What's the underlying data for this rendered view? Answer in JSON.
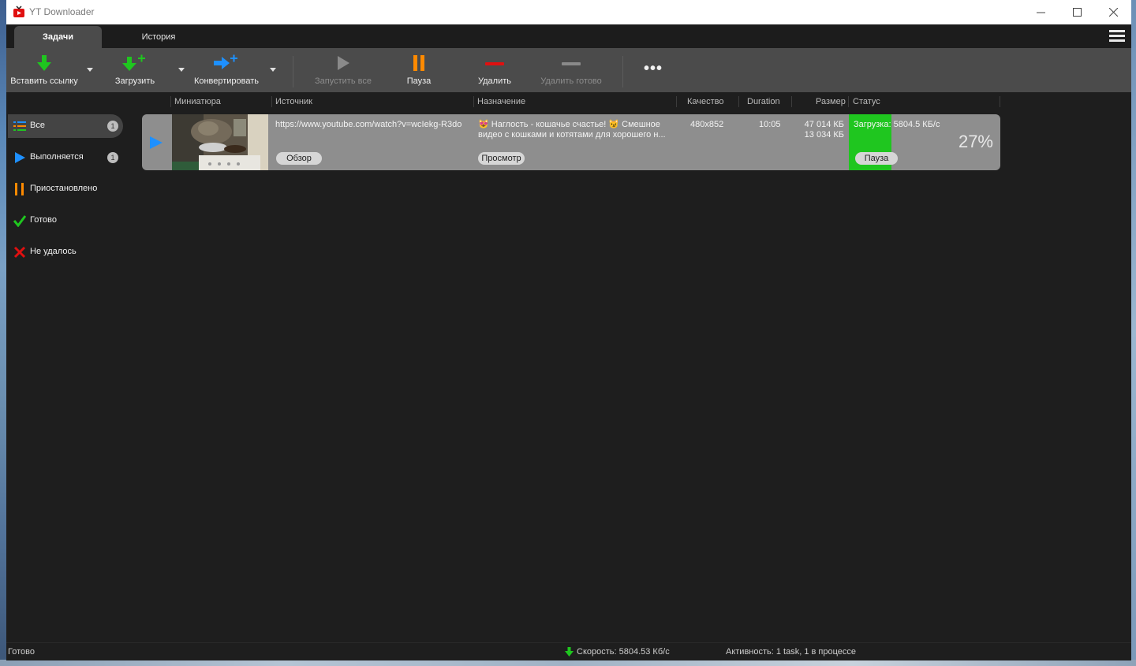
{
  "window": {
    "title": "YT Downloader",
    "controls": {
      "minimize": "—",
      "maximize": "☐",
      "close": "✕"
    }
  },
  "tabs": [
    {
      "label": "Задачи",
      "active": true
    },
    {
      "label": "История",
      "active": false
    }
  ],
  "toolbar": {
    "paste_link": "Вставить ссылку",
    "download": "Загрузить",
    "convert": "Конвертировать",
    "start_all": "Запустить все",
    "pause": "Пауза",
    "delete": "Удалить",
    "delete_done": "Удалить готово",
    "more": "•••"
  },
  "sidebar": {
    "items": [
      {
        "label": "Все",
        "icon": "list-icon",
        "badge": "1",
        "active": true
      },
      {
        "label": "Выполняется",
        "icon": "play-icon",
        "badge": "1"
      },
      {
        "label": "Приостановлено",
        "icon": "pause-icon"
      },
      {
        "label": "Готово",
        "icon": "checkmark-icon"
      },
      {
        "label": "Не удалось",
        "icon": "cross-icon"
      }
    ]
  },
  "columns": {
    "thumbnail": "Миниатюра",
    "source": "Источник",
    "destination": "Назначение",
    "quality": "Качество",
    "duration": "Duration",
    "size": "Размер",
    "status": "Статус"
  },
  "task": {
    "source_url": "https://www.youtube.com/watch?v=wcIekg-R3do",
    "browse_btn": "Обзор",
    "destination_line1": "😻 Наглость - кошачье счастье! 😼 Смешное",
    "destination_line2": "видео с кошками и котятами для хорошего н...",
    "view_btn": "Просмотр",
    "quality": "480x852",
    "duration": "10:05",
    "size_total": "47 014 КБ",
    "size_done": "13 034 КБ",
    "status": "Загрузка: 5804.5 КБ/с",
    "percent": "27%",
    "progress_fraction": 0.27,
    "pause_btn": "Пауза"
  },
  "statusbar": {
    "left": "Готово",
    "speed": "Скорость: 5804.53 Кб/с",
    "activity": "Активность: 1 task, 1 в процессе"
  },
  "colors": {
    "accent_green": "#1fc61f",
    "accent_blue": "#1e90ff",
    "accent_orange": "#ff8a00",
    "accent_red": "#e01010"
  }
}
